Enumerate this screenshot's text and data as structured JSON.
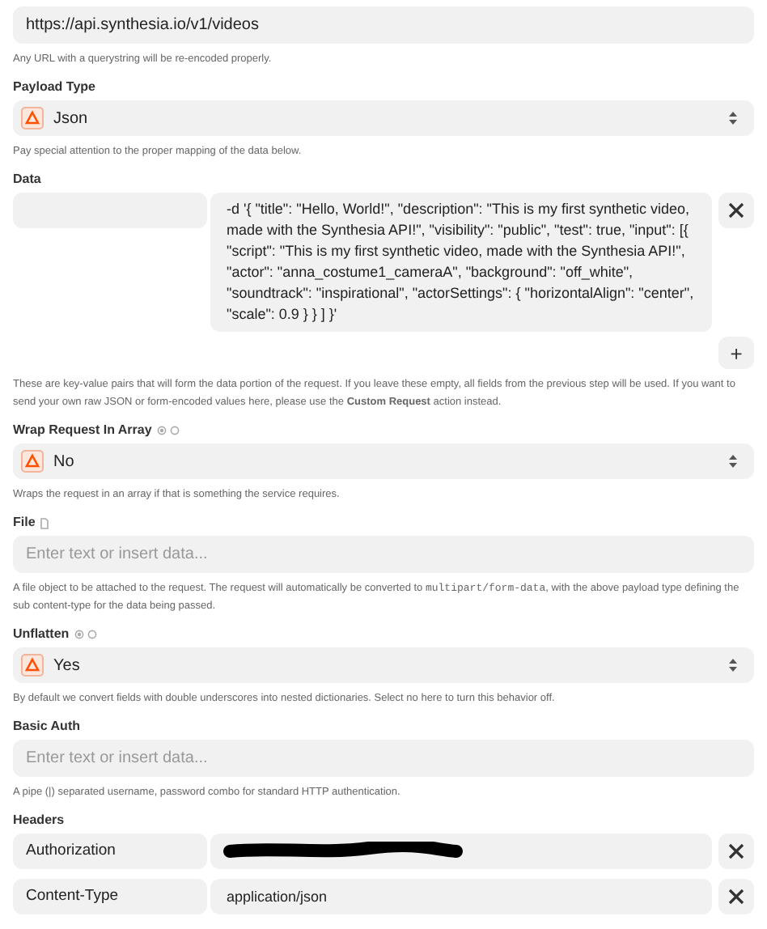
{
  "fields": [
    {
      "kind": "text",
      "value": "https://api.synthesia.io/v1/videos",
      "help": "Any URL with a querystring will be re-encoded properly."
    },
    {
      "kind": "select",
      "label": "Payload Type",
      "value": "Json",
      "help": "Pay special attention to the proper mapping of the data below."
    },
    {
      "kind": "pairs",
      "label": "Data",
      "rows": [
        {
          "value": "-d '{ \"title\": \"Hello, World!\", \"description\": \"This is my first synthetic video, made with the Synthesia API!\", \"visibility\": \"public\", \"test\": true, \"input\": [{ \"script\": \"This is my first synthetic video, made with the Synthesia API!\", \"actor\": \"anna_costume1_cameraA\", \"background\": \"off_white\", \"soundtrack\": \"inspirational\", \"actorSettings\": { \"horizontalAlign\": \"center\", \"scale\": 0.9 } } ] }'",
          "redacted": false
        }
      ],
      "add_button": "+",
      "help": "These are key-value pairs that will form the data portion of the request. If you leave these empty, all fields from the previous step will be used. If you want to send your own raw JSON or form-encoded values here, please use the **Custom Request** action instead."
    },
    {
      "kind": "select",
      "label": "Wrap Request In Array",
      "mapping_toggle": true,
      "value": "No",
      "help": "Wraps the request in an array if that is something the service requires."
    },
    {
      "kind": "text",
      "label": "File",
      "file_field": true,
      "placeholder": "Enter text or insert data...",
      "help": "A file object to be attached to the request. The request will automatically be converted to",
      "help_code": "multipart/form-data",
      "help_tail": ", with the above payload type defining the sub content-type for the data being passed."
    },
    {
      "kind": "select",
      "label": "Unflatten",
      "mapping_toggle": true,
      "value": "Yes",
      "help": "By default we convert fields with double underscores into nested dictionaries. Select no here to turn this behavior off."
    },
    {
      "kind": "text",
      "label": "Basic Auth",
      "placeholder": "Enter text or insert data...",
      "help": "A pipe (|) separated username, password combo for standard HTTP authentication."
    },
    {
      "kind": "pairs",
      "label": "Headers",
      "rows": [
        {
          "key": "Authorization",
          "redacted": true
        },
        {
          "key": "Content-Type",
          "value": "application/json",
          "redacted": false
        }
      ]
    }
  ]
}
